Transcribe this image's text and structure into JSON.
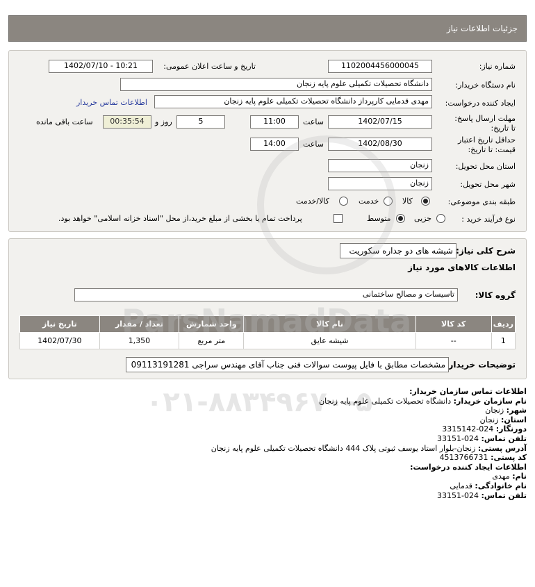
{
  "header": {
    "title": "جزئیات اطلاعات نیاز"
  },
  "form": {
    "need_number_label": "شماره نیاز:",
    "need_number": "1102004456000045",
    "announce_label": "تاریخ و ساعت اعلان عمومی:",
    "announce_value": "1402/07/10 - 10:21",
    "buyer_label": "نام دستگاه خریدار:",
    "buyer_value": "دانشگاه تحصیلات تکمیلی علوم پایه زنجان",
    "creator_label": "ایجاد کننده درخواست:",
    "creator_value": "مهدی قدمایی کارپرداز دانشگاه تحصیلات تکمیلی علوم پایه زنجان",
    "contact_link": "اطلاعات تماس خریدار",
    "deadline_label": "مهلت ارسال پاسخ: تا تاریخ:",
    "deadline_date": "1402/07/15",
    "time_label": "ساعت",
    "deadline_time": "11:00",
    "days_value": "5",
    "days_label": "روز و",
    "remaining_value": "00:35:54",
    "remaining_label": "ساعت باقی مانده",
    "validity_label": "حداقل تاریخ اعتبار قیمت: تا تاریخ:",
    "validity_date": "1402/08/30",
    "validity_time": "14:00",
    "province_label": "استان محل تحویل:",
    "province_value": "زنجان",
    "city_label": "شهر محل تحویل:",
    "city_value": "زنجان",
    "category_label": "طبقه بندی موضوعی:",
    "category_options": [
      "کالا",
      "خدمت",
      "کالا/خدمت"
    ],
    "process_label": "نوع فرآیند خرید :",
    "process_options": [
      "جزیی",
      "متوسط"
    ],
    "payment_text": "پرداخت تمام یا بخشی از مبلغ خرید،از محل \"اسناد خزانه اسلامی\" خواهد بود."
  },
  "need": {
    "desc_label": "شرح کلی نیاز:",
    "desc_value": "شیشه های دو جداره سکوریت",
    "goods_info_label": "اطلاعات کالاهای مورد نیاز",
    "group_label": "گروه کالا:",
    "group_value": "تاسیسات و مصالح ساختمانی",
    "table": {
      "headers": [
        "ردیف",
        "کد کالا",
        "نام کالا",
        "واحد شمارش",
        "تعداد / مقدار",
        "تاریخ نیاز"
      ],
      "rows": [
        [
          "1",
          "--",
          "شیشه عایق",
          "متر مربع",
          "1,350",
          "1402/07/30"
        ]
      ]
    },
    "buyer_notes_label": "توضیحات خریدار:",
    "buyer_notes_value": "مشخصات مطابق با فایل پیوست سوالات فنی جناب آقای مهندس سراجی 09113191281"
  },
  "contact": {
    "title": "اطلاعات تماس سازمان خریدار:",
    "org_label": "نام سازمان خریدار:",
    "org_value": "دانشگاه تحصیلات تکمیلی علوم پایه زنجان",
    "city_label": "شهر:",
    "city_value": "زنجان",
    "province_label": "استان:",
    "province_value": "زنجان",
    "fax_label": "دورنگار:",
    "fax_value": "024-3315142",
    "phone_label": "تلفن تماس:",
    "phone_value": "024-33151",
    "address_label": "آدرس پستی:",
    "address_value": "زنجان-بلوار استاد یوسف ثبوتی پلاک 444 دانشگاه تحصیلات تکمیلی علوم پایه زنجان",
    "postal_label": "کد پستی:",
    "postal_value": "4513766731",
    "creator_title": "اطلاعات ایجاد کننده درخواست:",
    "name_label": "نام:",
    "name_value": "مهدی",
    "family_label": "نام خانوادگی:",
    "family_value": "قدمایی",
    "creator_phone_label": "تلفن تماس:",
    "creator_phone_value": "024-33151"
  },
  "watermark": {
    "brand": "ParsNamadData",
    "phone": "۰۲۱-۸۸۳۴۹۶۷۰-۵"
  },
  "colors": {
    "header_bg": "#8b8680",
    "panel_bg": "#f2f1ee",
    "link": "#2a3d9e"
  }
}
